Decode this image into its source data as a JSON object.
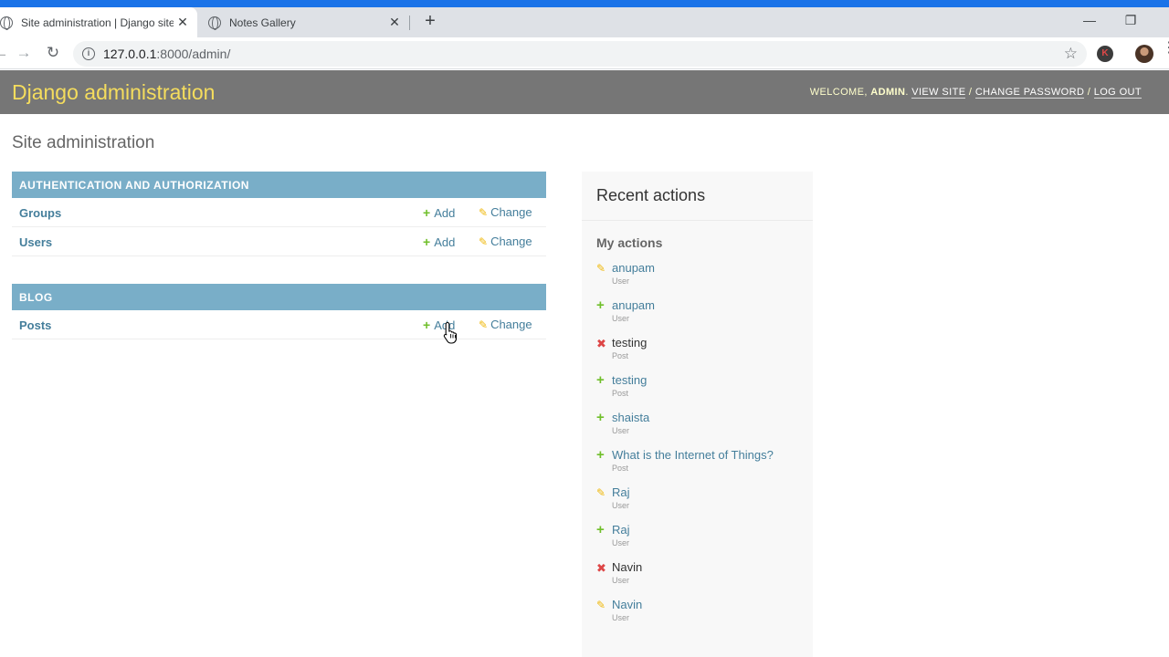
{
  "browser": {
    "tabs": [
      {
        "title": "Site administration | Django site admin",
        "close": "✕"
      },
      {
        "title": "Notes Gallery",
        "close": "✕"
      }
    ],
    "new_tab": "+",
    "url_host": "127.0.0.1",
    "url_path": ":8000/admin/",
    "window_controls": {
      "minimize": "—",
      "restore": "❐",
      "close": "✕"
    },
    "extension_letter": "K"
  },
  "header": {
    "branding": "Django administration",
    "welcome": "WELCOME, ",
    "username": "ADMIN",
    "view_site": "VIEW SITE",
    "change_password": "CHANGE PASSWORD",
    "log_out": "LOG OUT",
    "separator": " / "
  },
  "content": {
    "title": "Site administration",
    "modules": [
      {
        "caption": "AUTHENTICATION AND AUTHORIZATION",
        "models": [
          {
            "name": "Groups",
            "add": "Add",
            "change": "Change"
          },
          {
            "name": "Users",
            "add": "Add",
            "change": "Change"
          }
        ]
      },
      {
        "caption": "BLOG",
        "models": [
          {
            "name": "Posts",
            "add": "Add",
            "change": "Change"
          }
        ]
      }
    ]
  },
  "recent_actions": {
    "title": "Recent actions",
    "subtitle": "My actions",
    "items": [
      {
        "action": "change",
        "object": "anupam",
        "type": "User"
      },
      {
        "action": "add",
        "object": "anupam",
        "type": "User"
      },
      {
        "action": "delete",
        "object": "testing",
        "type": "Post"
      },
      {
        "action": "add",
        "object": "testing",
        "type": "Post"
      },
      {
        "action": "add",
        "object": "shaista",
        "type": "User"
      },
      {
        "action": "add",
        "object": "What is the Internet of Things?",
        "type": "Post"
      },
      {
        "action": "change",
        "object": "Raj",
        "type": "User"
      },
      {
        "action": "add",
        "object": "Raj",
        "type": "User"
      },
      {
        "action": "delete",
        "object": "Navin",
        "type": "User"
      },
      {
        "action": "change",
        "object": "Navin",
        "type": "User"
      }
    ]
  },
  "colors": {
    "header_bg": "#767676",
    "branding": "#f5dd5d",
    "module_caption_bg": "#79aec8",
    "link": "#447e9b",
    "add_green": "#70bf2b",
    "change_yellow": "#efb80b",
    "delete_red": "#dd4646"
  },
  "icons": {
    "add": "plus-icon",
    "change": "pencil-icon",
    "delete": "x-icon"
  }
}
